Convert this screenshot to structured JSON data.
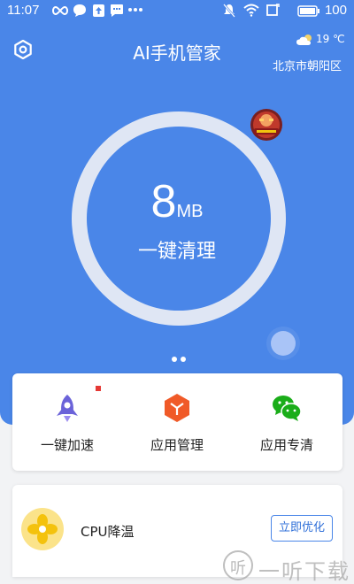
{
  "status_bar": {
    "time": "11:07",
    "battery": "100",
    "left_icons": [
      "infinity-icon",
      "chat-bubble-icon",
      "upload-icon",
      "message-icon",
      "more-dots-icon"
    ],
    "right_icons": [
      "mute-icon",
      "wifi-icon",
      "rotate-icon",
      "battery-icon"
    ]
  },
  "header": {
    "title": "AI手机管家",
    "weather_temp": "19 ℃",
    "location": "北京市朝阳区"
  },
  "memory": {
    "value": "8",
    "unit": "MB",
    "action_label": "一键清理"
  },
  "features": [
    {
      "label": "一键加速",
      "icon": "rocket-icon",
      "color": "#6b63d9"
    },
    {
      "label": "应用管理",
      "icon": "cube-icon",
      "color": "#f05a28"
    },
    {
      "label": "应用专清",
      "icon": "wechat-icon",
      "color": "#1aad19"
    }
  ],
  "cpu": {
    "label": "CPU降温",
    "button": "立即优化",
    "icon": "fan-icon"
  },
  "watermark": {
    "icon_char": "听",
    "text": "一听下载"
  },
  "colors": {
    "primary": "#4a86e8",
    "ring": "#dfe6f4",
    "background": "#f2f3f5"
  }
}
